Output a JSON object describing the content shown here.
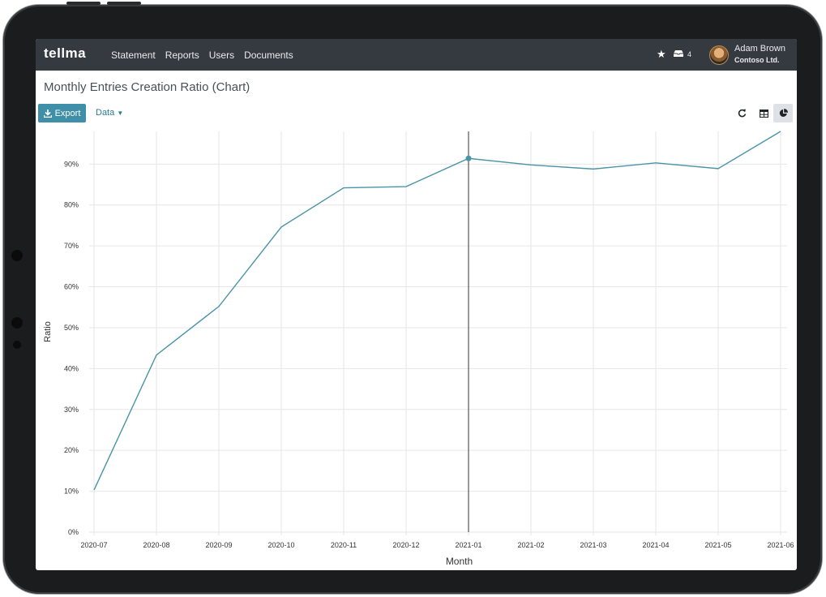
{
  "app": {
    "logo": "tellma",
    "nav": [
      "Statement",
      "Reports",
      "Users",
      "Documents"
    ],
    "inbox_count": "4",
    "user_name": "Adam Brown",
    "company": "Contoso Ltd."
  },
  "page": {
    "title": "Monthly Entries Creation Ratio (Chart)",
    "export_label": "Export",
    "data_label": "Data"
  },
  "colors": {
    "topbar": "#343a40",
    "accent": "#3f8fa8",
    "line": "#4a94a8"
  },
  "chart_data": {
    "type": "line",
    "xlabel": "Month",
    "ylabel": "Ratio",
    "categories": [
      "2020-07",
      "2020-08",
      "2020-09",
      "2020-10",
      "2020-11",
      "2020-12",
      "2021-01",
      "2021-02",
      "2021-03",
      "2021-04",
      "2021-05",
      "2021-06"
    ],
    "series": [
      {
        "values": [
          10.3,
          43.3,
          55.2,
          74.6,
          84.2,
          84.5,
          91.4,
          89.8,
          88.8,
          90.3,
          88.9,
          98.0
        ]
      }
    ],
    "ylim": [
      0,
      98
    ],
    "yticks": [
      "0%",
      "10%",
      "20%",
      "30%",
      "40%",
      "50%",
      "60%",
      "70%",
      "80%",
      "90%"
    ],
    "ytick_values": [
      0,
      10,
      20,
      30,
      40,
      50,
      60,
      70,
      80,
      90
    ],
    "grid": true,
    "highlighted_index": 6
  }
}
